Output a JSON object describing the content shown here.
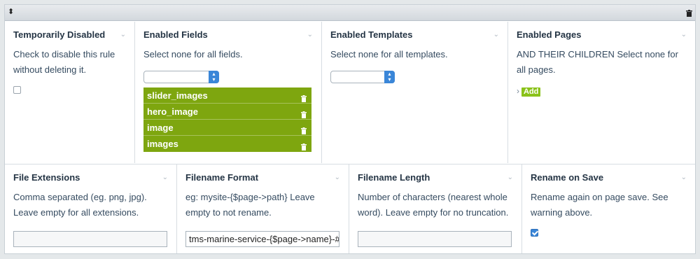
{
  "toolbar": {
    "drag_icon": "drag-handle-icon",
    "delete_icon": "trash-icon"
  },
  "row1": {
    "temporarily_disabled": {
      "title": "Temporarily Disabled",
      "description": "Check to disable this rule without deleting it.",
      "checked": false
    },
    "enabled_fields": {
      "title": "Enabled Fields",
      "description": "Select none for all fields.",
      "select_value": "",
      "items": [
        "slider_images",
        "hero_image",
        "image",
        "images"
      ]
    },
    "enabled_templates": {
      "title": "Enabled Templates",
      "description": "Select none for all templates.",
      "select_value": ""
    },
    "enabled_pages": {
      "title": "Enabled Pages",
      "description": "AND THEIR CHILDREN Select none for all pages.",
      "add_label": "Add"
    }
  },
  "row2": {
    "file_extensions": {
      "title": "File Extensions",
      "description": "Comma separated (eg. png, jpg). Leave empty for all extensions.",
      "value": ""
    },
    "filename_format": {
      "title": "Filename Format",
      "description": "eg: mysite-{$page->path} Leave empty to not rename.",
      "value": "tms-marine-service-{$page->name}-#"
    },
    "filename_length": {
      "title": "Filename Length",
      "description": "Number of characters (nearest whole word). Leave empty for no truncation.",
      "value": ""
    },
    "rename_on_save": {
      "title": "Rename on Save",
      "description": "Rename again on page save. See warning above.",
      "checked": true
    }
  },
  "colors": {
    "accent_green": "#7ea60f",
    "accent_blue": "#3a86d8"
  }
}
